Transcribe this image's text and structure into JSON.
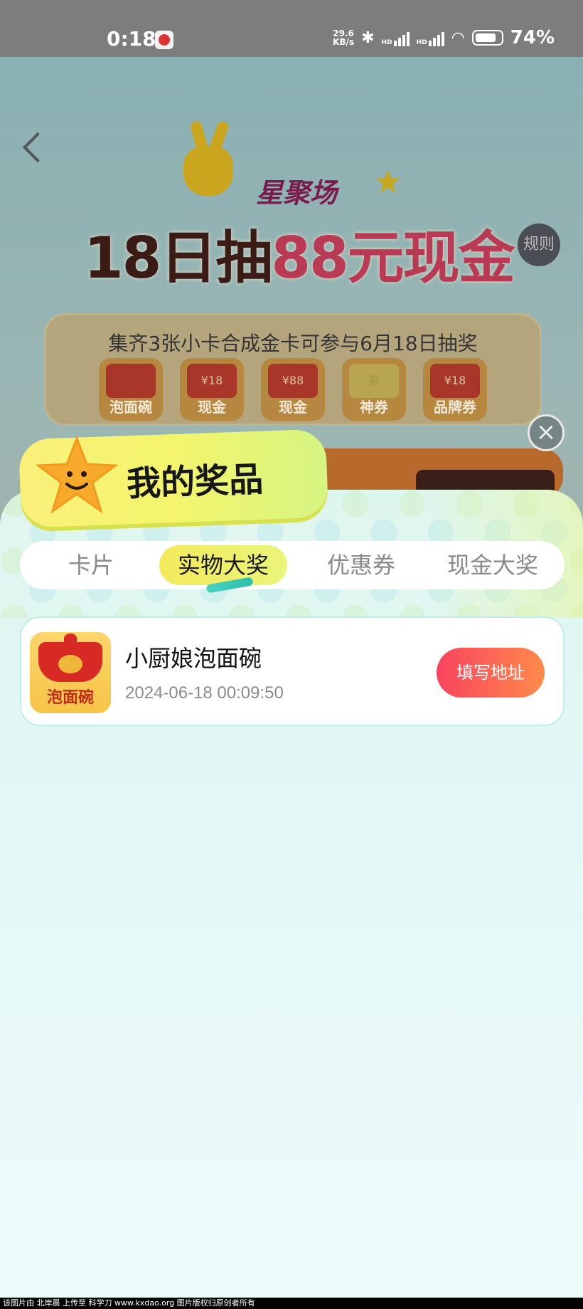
{
  "status_bar": {
    "time": "0:18",
    "net_speed_value": "29.6",
    "net_speed_unit": "KB/s",
    "bluetooth_icon": "bluetooth-icon",
    "hd1": "HD",
    "hd2": "HD",
    "battery": "74%"
  },
  "background": {
    "brand": "星聚场",
    "title_part1": "18日抽",
    "title_part2": "88元现金",
    "rules": "规则",
    "card_panel_text": "集齐3张小卡合成金卡可参与6月18日抽奖",
    "cards": [
      {
        "top": "",
        "label": "泡面碗"
      },
      {
        "top": "¥18",
        "label": "现金"
      },
      {
        "top": "¥88",
        "label": "现金"
      },
      {
        "top": "券",
        "label": "神券"
      },
      {
        "top": "¥18",
        "label": "品牌券"
      }
    ]
  },
  "sheet": {
    "title": "我的奖品",
    "tabs": [
      "卡片",
      "实物大奖",
      "优惠券",
      "现金大奖"
    ],
    "active_tab": 1,
    "items": [
      {
        "thumb_label": "泡面碗",
        "name": "小厨娘泡面碗",
        "time": "2024-06-18 00:09:50",
        "action": "填写地址"
      }
    ]
  },
  "watermark": "该图片由 北岸晨 上传至 科学刀 www.kxdao.org 图片版权归原创者所有",
  "colors": {
    "accent_button_start": "#f9435f",
    "accent_button_end": "#ff8a4a",
    "tab_highlight": "#f3ea5c"
  }
}
